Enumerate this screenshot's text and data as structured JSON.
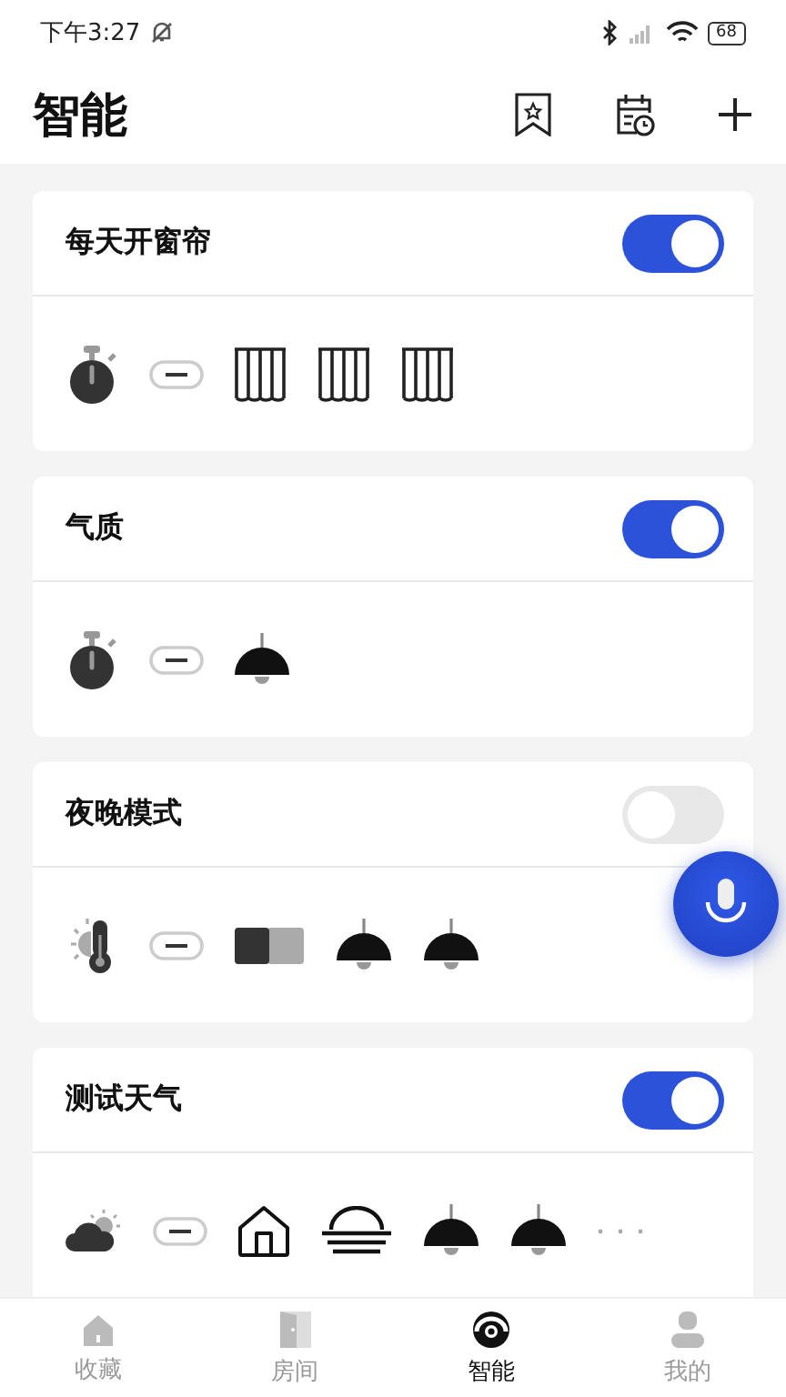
{
  "status_bar": {
    "time": "下午3:27",
    "battery": "68"
  },
  "header": {
    "title": "智能",
    "actions": [
      {
        "kind": "bookmark"
      },
      {
        "kind": "calendar"
      },
      {
        "kind": "add"
      }
    ]
  },
  "scenes": [
    {
      "name": "每天开窗帘",
      "on": true,
      "trigger": {
        "kind": "timer"
      },
      "actions": [
        {
          "kind": "curtain"
        },
        {
          "kind": "curtain"
        },
        {
          "kind": "curtain"
        }
      ]
    },
    {
      "name": "气质",
      "on": true,
      "trigger": {
        "kind": "timer"
      },
      "actions": [
        {
          "kind": "lamp"
        }
      ]
    },
    {
      "name": "夜晚模式",
      "on": false,
      "trigger": {
        "kind": "weather-temp"
      },
      "actions": [
        {
          "kind": "panel"
        },
        {
          "kind": "lamp"
        },
        {
          "kind": "lamp"
        }
      ]
    },
    {
      "name": "测试天气",
      "on": true,
      "trigger": {
        "kind": "cloud-sun"
      },
      "actions": [
        {
          "kind": "house"
        },
        {
          "kind": "dome"
        },
        {
          "kind": "lamp"
        },
        {
          "kind": "lamp"
        },
        {
          "kind": "more"
        }
      ]
    }
  ],
  "nav": [
    {
      "label": "收藏",
      "kind": "home",
      "selected": false
    },
    {
      "label": "房间",
      "kind": "door",
      "selected": false
    },
    {
      "label": "智能",
      "kind": "smart",
      "selected": true
    },
    {
      "label": "我的",
      "kind": "person",
      "selected": false
    }
  ]
}
